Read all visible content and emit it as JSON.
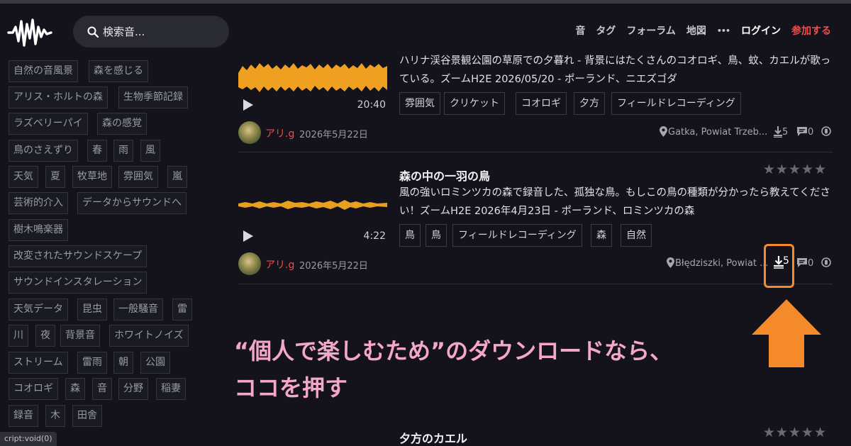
{
  "header": {
    "search_placeholder": "検索音...",
    "nav": [
      "音",
      "タグ",
      "フォーラム",
      "地図",
      "•••"
    ],
    "login": "ログイン",
    "join": "参加する"
  },
  "sidebar": {
    "tags": [
      "自然の音風景",
      "森を感じる",
      "アリス・ホルトの森",
      "生物季節記録",
      "ラズベリーパイ",
      "森の感覚",
      "鳥のさえずり",
      "春",
      "雨",
      "風",
      "天気",
      "夏",
      "牧草地",
      "雰囲気",
      "嵐",
      "芸術的介入",
      "データからサウンドへ",
      "樹木鳴楽器",
      "改変されたサウンドスケープ",
      "サウンドインスタレーション",
      "天気データ",
      "昆虫",
      "一般騒音",
      "雷",
      "川",
      "夜",
      "背景音",
      "ホワイトノイズ",
      "ストリーム",
      "雷雨",
      "朝",
      "公園",
      "コオロギ",
      "森",
      "音",
      "分野",
      "稲妻",
      "録音",
      "木",
      "田舎"
    ]
  },
  "status_bar": "cript:void(0)",
  "tracks": [
    {
      "desc": "ハリナ渓谷景観公園の草原での夕暮れ - 背景にはたくさんのコオロギ、鳥、蚊、カエルが歌っている。ズームH2E 2026/05/20 - ポーランド、ニエズゴダ",
      "duration": "20:40",
      "tags": [
        "雰囲気",
        "クリケット",
        "コオロギ",
        "夕方",
        "フィールドレコーディング"
      ],
      "user": "アリ.g",
      "date": "2026年5月22日",
      "location": "Gatka, Powiat Trzeb...",
      "downloads": "5",
      "comments": "0"
    },
    {
      "title": "森の中の一羽の鳥",
      "stars": "★★★★★",
      "desc": "風の強いロミンツカの森で録音した、孤独な鳥。もしこの鳥の種類が分かったら教えてください！ズームH2E 2026年4月23日 - ポーランド、ロミンツカの森",
      "duration": "4:22",
      "tags": [
        "鳥",
        "鳥",
        "フィールドレコーディング",
        "森",
        "自然"
      ],
      "user": "アリ.g",
      "date": "2026年5月22日",
      "location": "Błędziszki, Powiat ...",
      "downloads": "5",
      "comments": "0"
    },
    {
      "title": "夕方のカエル",
      "stars": "★★★★★"
    }
  ],
  "annotation": {
    "line1": "“個人で楽しむため”のダウンロードなら、",
    "line2": "ココを押す",
    "highlight_color": "#f58a2a",
    "text_color": "#f2a8c6"
  },
  "colors": {
    "accent": "#e8504c",
    "waveform1": "#f0a020",
    "waveform2": "#e8a020"
  }
}
